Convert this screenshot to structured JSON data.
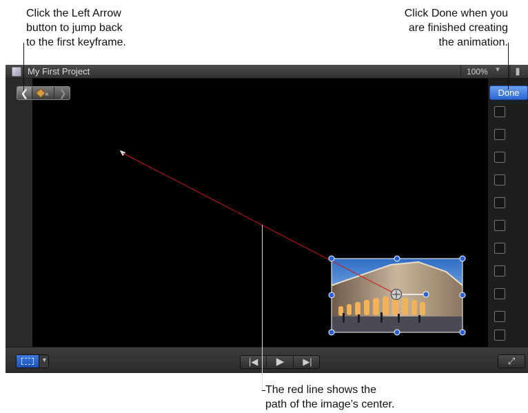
{
  "callouts": {
    "left": [
      "Click the Left Arrow",
      "button to jump back",
      "to the first keyframe."
    ],
    "right": [
      "Click Done when you",
      "are finished creating",
      "the animation."
    ],
    "bottom": [
      "The red line shows the",
      "path of the image’s center."
    ]
  },
  "viewer": {
    "title": "My First Project",
    "zoom": "100%",
    "zoom_arrow": "▼",
    "done_label": "Done",
    "keyframe_nav": {
      "prev": "❮",
      "toggle_mark": "×",
      "next": "❯"
    },
    "transport": {
      "back": "|◀",
      "play": "▶",
      "forward": "▶|"
    },
    "fullscreen": "⤢",
    "icons": [
      "project-icon",
      "chevron-left-icon",
      "keyframe-diamond-icon",
      "chevron-right-icon",
      "transform-view-icon",
      "skip-back-icon",
      "play-icon",
      "skip-forward-icon",
      "fullscreen-icon",
      "view-options-icon"
    ],
    "colors": {
      "accent": "#2c66d4",
      "path_line": "#cc1a1a",
      "handle": "#2a5fd8"
    }
  }
}
